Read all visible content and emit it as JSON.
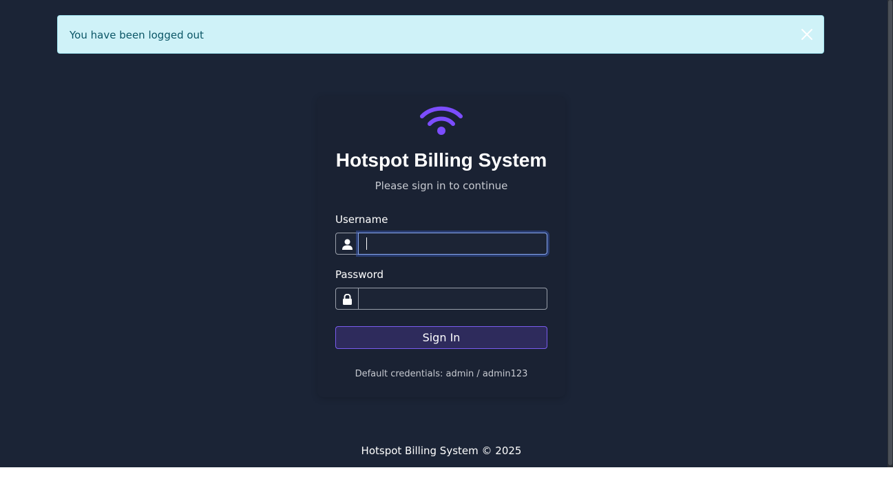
{
  "alert": {
    "message": "You have been logged out",
    "close_icon": "close-icon"
  },
  "login": {
    "logo_icon": "wifi-icon",
    "title": "Hotspot Billing System",
    "subtitle": "Please sign in to continue",
    "username": {
      "label": "Username",
      "value": "",
      "icon": "user-icon"
    },
    "password": {
      "label": "Password",
      "value": "",
      "icon": "lock-icon"
    },
    "submit_label": "Sign In",
    "hint": "Default credentials: admin / admin123"
  },
  "footer": {
    "text": "Hotspot Billing System © 2025"
  },
  "colors": {
    "background": "#1b2436",
    "accent": "#7c4dff",
    "alert_bg": "#cff2f8",
    "alert_text": "#0b5666",
    "button_bg": "#2e2b5c"
  }
}
